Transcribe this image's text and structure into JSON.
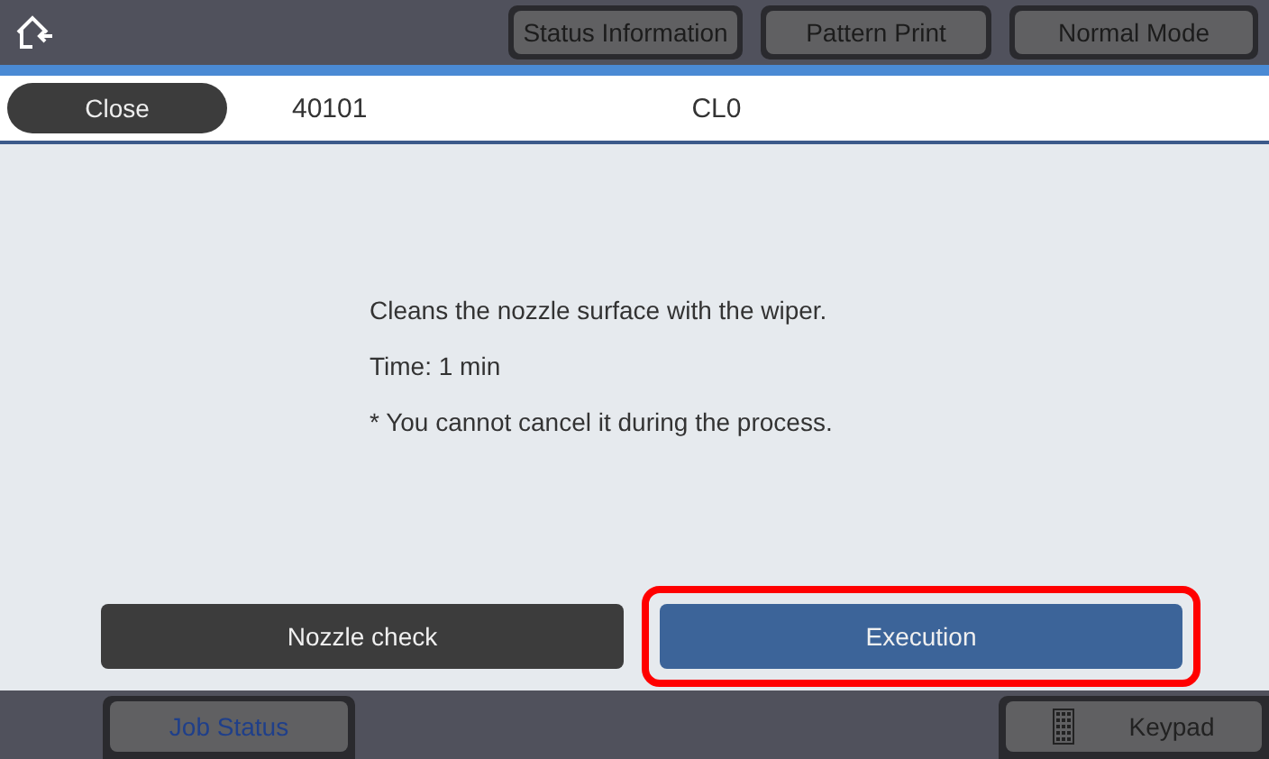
{
  "header": {
    "buttons": [
      "Status Information",
      "Pattern Print",
      "Normal Mode"
    ]
  },
  "info_row": {
    "close_button": "Close",
    "code": "40101",
    "name": "CL0"
  },
  "message": [
    "Cleans the nozzle surface with the wiper.",
    "Time: 1 min",
    "* You cannot cancel it during the process."
  ],
  "actions": [
    {
      "label": "Nozzle check",
      "kind": "secondary",
      "highlighted": false
    },
    {
      "label": "Execution",
      "kind": "primary",
      "highlighted": true
    }
  ],
  "footer": {
    "job_status": "Job Status",
    "keypad": "Keypad"
  }
}
